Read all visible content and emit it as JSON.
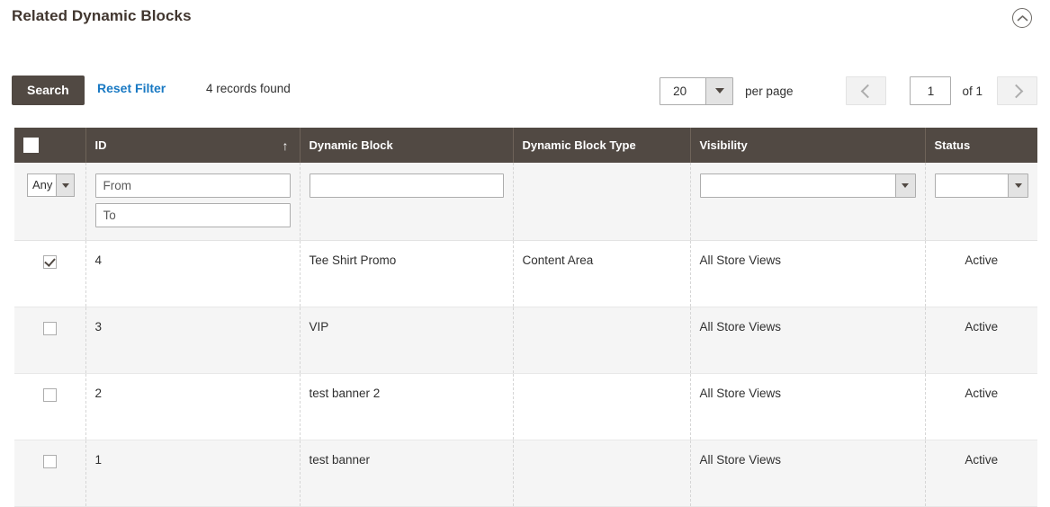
{
  "section": {
    "title": "Related Dynamic Blocks",
    "collapse_icon": "chevron-up-circle-icon"
  },
  "toolbar": {
    "search_label": "Search",
    "reset_filter_label": "Reset Filter",
    "records_found": "4 records found"
  },
  "pager": {
    "limit_value": "20",
    "per_page_label": "per page",
    "prev_icon": "chevron-left-icon",
    "next_icon": "chevron-right-icon",
    "current_page": "1",
    "of_total_label": "of 1"
  },
  "grid": {
    "columns": [
      {
        "key": "checkbox",
        "label": ""
      },
      {
        "key": "id",
        "label": "ID",
        "sort": "asc",
        "sort_glyph": "↑"
      },
      {
        "key": "block",
        "label": "Dynamic Block"
      },
      {
        "key": "type",
        "label": "Dynamic Block Type"
      },
      {
        "key": "visibility",
        "label": "Visibility"
      },
      {
        "key": "status",
        "label": "Status"
      }
    ],
    "filters": {
      "massaction_value": "Any",
      "id_from_placeholder": "From",
      "id_to_placeholder": "To",
      "id_from_value": "",
      "id_to_value": "",
      "block_value": "",
      "visibility_value": "",
      "status_value": ""
    },
    "rows": [
      {
        "selected": true,
        "id": "4",
        "block": "Tee Shirt Promo",
        "type": "Content Area",
        "visibility": "All Store Views",
        "status": "Active"
      },
      {
        "selected": false,
        "id": "3",
        "block": "VIP",
        "type": "",
        "visibility": "All Store Views",
        "status": "Active"
      },
      {
        "selected": false,
        "id": "2",
        "block": "test banner 2",
        "type": "",
        "visibility": "All Store Views",
        "status": "Active"
      },
      {
        "selected": false,
        "id": "1",
        "block": "test banner",
        "type": "",
        "visibility": "All Store Views",
        "status": "Active"
      }
    ]
  },
  "colors": {
    "header_bg": "#514943",
    "link": "#1979c3",
    "button_bg": "#514943",
    "row_alt_bg": "#f5f5f5"
  }
}
